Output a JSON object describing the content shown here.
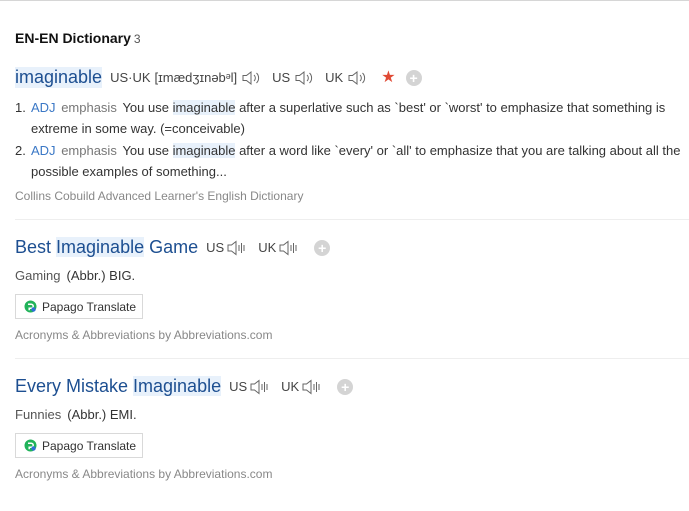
{
  "section": {
    "title": "EN-EN Dictionary",
    "count": "3"
  },
  "entry1": {
    "headword": "imaginable",
    "us_uk_label": "US·UK",
    "pronunciation": "[ɪmædʒɪnəbᵊl]",
    "us_label": "US",
    "uk_label": "UK",
    "senses": [
      {
        "num": "1.",
        "pos": "ADJ",
        "gram": "emphasis",
        "pre": "You use ",
        "hl": "imaginable",
        "post": " after a superlative such as `best' or `worst' to emphasize that something is extreme in some way. (=conceivable)"
      },
      {
        "num": "2.",
        "pos": "ADJ",
        "gram": "emphasis",
        "pre": "You use ",
        "hl": "imaginable",
        "post": " after a word like `every' or `all' to emphasize that you are talking about all the possible examples of something..."
      }
    ],
    "source": "Collins Cobuild Advanced Learner's English Dictionary"
  },
  "entry2": {
    "title_plain": "Best ",
    "title_hl": "Imaginable",
    "title_plain2": " Game",
    "us_label": "US",
    "uk_label": "UK",
    "category": "Gaming",
    "abbr": "(Abbr.) BIG.",
    "papago_label": "Papago Translate",
    "source": "Acronyms & Abbreviations by Abbreviations.com"
  },
  "entry3": {
    "title_plain": "Every Mistake ",
    "title_hl": "Imaginable",
    "us_label": "US",
    "uk_label": "UK",
    "category": "Funnies",
    "abbr": "(Abbr.) EMI.",
    "papago_label": "Papago Translate",
    "source": "Acronyms & Abbreviations by Abbreviations.com"
  },
  "colors": {
    "link_blue": "#1d4f91",
    "pos_blue": "#3b78c6",
    "highlight": "#e8f1fb",
    "star": "#e04a35"
  }
}
